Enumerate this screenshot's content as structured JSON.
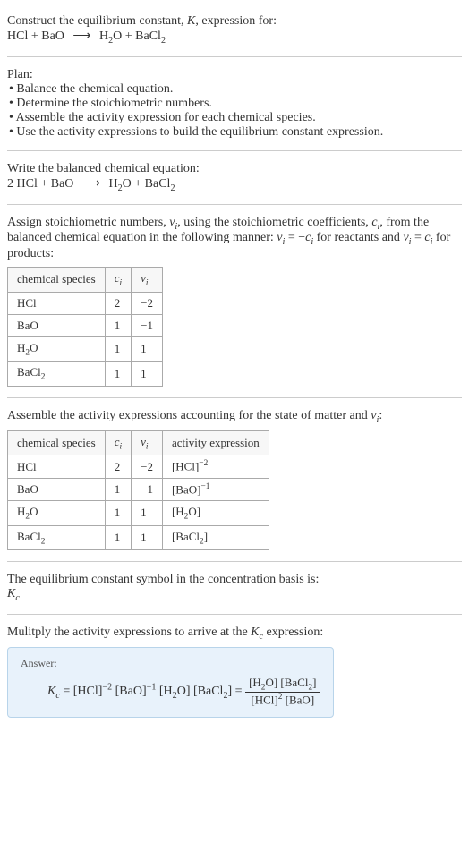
{
  "header": {
    "line1": "Construct the equilibrium constant, ",
    "K": "K",
    "line1b": ", expression for:",
    "eq_lhs_a": "HCl + BaO",
    "arrow": "⟶",
    "eq_rhs_a": "H",
    "eq_rhs_sub2": "2",
    "eq_rhs_b": "O + BaCl",
    "eq_rhs_sub2b": "2"
  },
  "plan": {
    "title": "Plan:",
    "items": [
      "Balance the chemical equation.",
      "Determine the stoichiometric numbers.",
      "Assemble the activity expression for each chemical species.",
      "Use the activity expressions to build the equilibrium constant expression."
    ]
  },
  "balanced": {
    "title": "Write the balanced chemical equation:",
    "lhs": "2 HCl + BaO",
    "rhs_a": "H",
    "rhs_sub2": "2",
    "rhs_b": "O + BaCl",
    "rhs_sub2b": "2"
  },
  "assign": {
    "text_a": "Assign stoichiometric numbers, ",
    "nu": "ν",
    "sub_i": "i",
    "text_b": ", using the stoichiometric coefficients, ",
    "c": "c",
    "text_c": ", from the balanced chemical equation in the following manner: ",
    "rel1_lhs": "ν",
    "rel1_eq": " = −",
    "rel1_rhs": "c",
    "text_d": " for reactants and ",
    "rel2_lhs": "ν",
    "rel2_eq": " = ",
    "rel2_rhs": "c",
    "text_e": " for products:"
  },
  "table1": {
    "h1": "chemical species",
    "h2": "c",
    "h2sub": "i",
    "h3": "ν",
    "h3sub": "i",
    "rows": [
      {
        "sp": "HCl",
        "c": "2",
        "v": "−2"
      },
      {
        "sp": "BaO",
        "c": "1",
        "v": "−1"
      },
      {
        "sp_a": "H",
        "sp_sub": "2",
        "sp_b": "O",
        "c": "1",
        "v": "1"
      },
      {
        "sp_a": "BaCl",
        "sp_sub": "2",
        "sp_b": "",
        "c": "1",
        "v": "1"
      }
    ]
  },
  "assemble": {
    "text_a": "Assemble the activity expressions accounting for the state of matter and ",
    "nu": "ν",
    "sub_i": "i",
    "text_b": ":"
  },
  "table2": {
    "h1": "chemical species",
    "h2": "c",
    "h2sub": "i",
    "h3": "ν",
    "h3sub": "i",
    "h4": "activity expression",
    "rows": [
      {
        "sp": "HCl",
        "c": "2",
        "v": "−2",
        "act_base": "[HCl]",
        "act_exp": "−2"
      },
      {
        "sp": "BaO",
        "c": "1",
        "v": "−1",
        "act_base": "[BaO]",
        "act_exp": "−1"
      },
      {
        "sp_a": "H",
        "sp_sub": "2",
        "sp_b": "O",
        "c": "1",
        "v": "1",
        "act_a": "[H",
        "act_sub": "2",
        "act_b": "O]"
      },
      {
        "sp_a": "BaCl",
        "sp_sub": "2",
        "sp_b": "",
        "c": "1",
        "v": "1",
        "act_a": "[BaCl",
        "act_sub": "2",
        "act_b": "]"
      }
    ]
  },
  "symbol": {
    "text": "The equilibrium constant symbol in the concentration basis is:",
    "K": "K",
    "sub": "c"
  },
  "multiply": {
    "text_a": "Mulitply the activity expressions to arrive at the ",
    "K": "K",
    "sub": "c",
    "text_b": " expression:"
  },
  "answer": {
    "label": "Answer:",
    "Kc_K": "K",
    "Kc_sub": "c",
    "eq": " = ",
    "p1_base": "[HCl]",
    "p1_exp": "−2",
    "p2_base": " [BaO]",
    "p2_exp": "−1",
    "p3_a": " [H",
    "p3_sub": "2",
    "p3_b": "O]",
    "p4_a": " [BaCl",
    "p4_sub": "2",
    "p4_b": "]",
    "eq2": " = ",
    "num_a": "[H",
    "num_sub1": "2",
    "num_b": "O] [BaCl",
    "num_sub2": "2",
    "num_c": "]",
    "den_a": "[HCl]",
    "den_exp": "2",
    "den_b": " [BaO]"
  }
}
